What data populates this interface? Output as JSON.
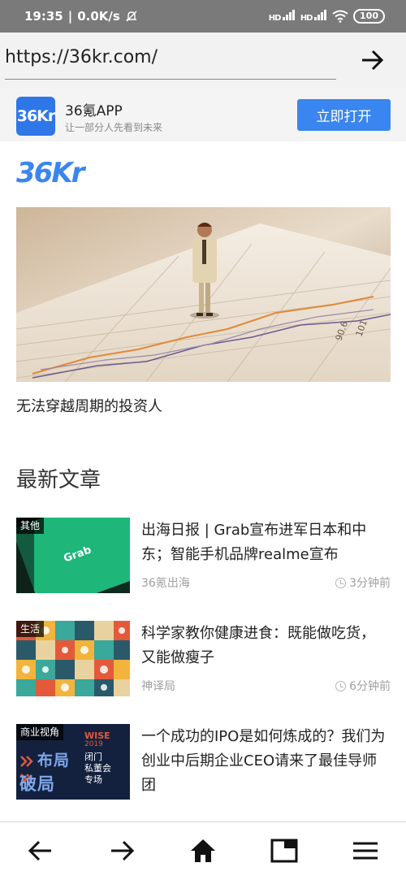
{
  "status_bar": {
    "time": "19:35",
    "speed": "0.0K/s",
    "sim1": "HD",
    "sim2": "HD",
    "battery": "100"
  },
  "address_bar": {
    "url": "https://36kr.com/"
  },
  "banner": {
    "icon_text": "36Kr",
    "app_name": "36氪APP",
    "slogan": "让一部分人先看到未来",
    "open_button": "立即打开"
  },
  "site_logo": "36Kr",
  "hero": {
    "caption": "无法穿越周期的投资人"
  },
  "section_title": "最新文章",
  "articles": [
    {
      "tag": "其他",
      "title": "出海日报 | Grab宣布进军日本和中东；智能手机品牌realme宣布",
      "source": "36氪出海",
      "time": "3分钟前",
      "thumb_text": "Grab"
    },
    {
      "tag": "生活",
      "title": "科学家教你健康进食：既能做吃货，又能做瘦子",
      "source": "神译局",
      "time": "6分钟前"
    },
    {
      "tag": "商业视角",
      "title": "一个成功的IPO是如何炼成的？我们为创业中后期企业CEO请来了最佳导师团",
      "thumb_lines": [
        "布局",
        "破局",
        "WISE",
        "2019",
        "闭门",
        "私董会",
        "专场"
      ]
    }
  ],
  "colors": {
    "accent": "#3a86f0",
    "status_bar": "#7a7a7a",
    "grab_green": "#1fb67a",
    "wise_navy": "#13213f"
  },
  "icons": {
    "back": "arrow-left-icon",
    "forward": "arrow-right-icon",
    "home": "home-icon",
    "tabs": "tabs-icon",
    "menu": "menu-icon"
  }
}
